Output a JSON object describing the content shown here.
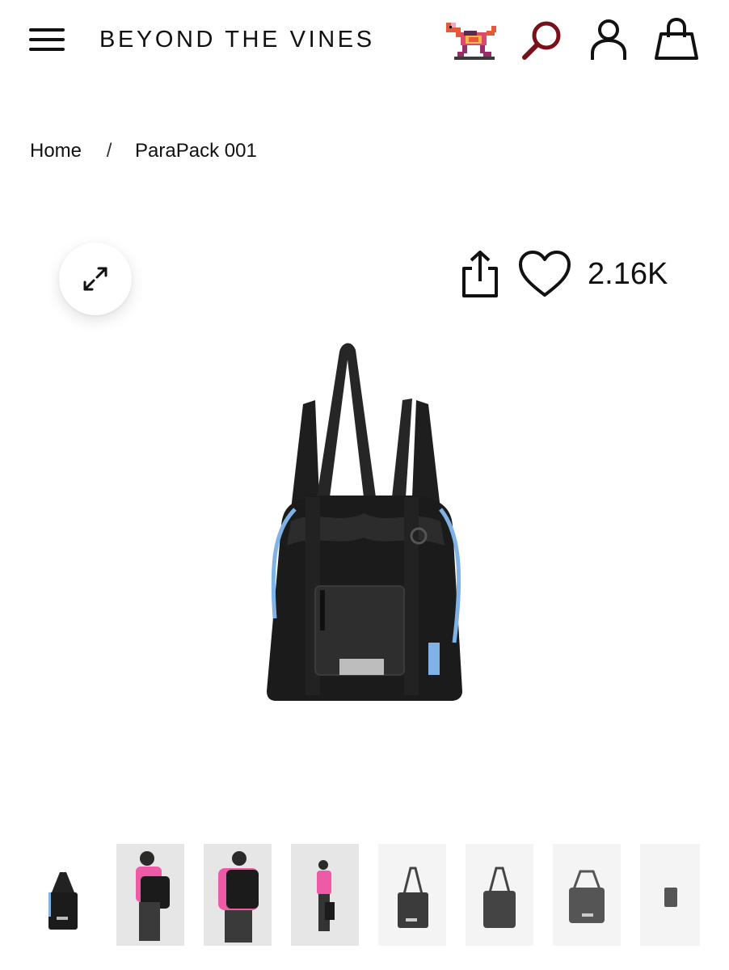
{
  "header": {
    "brand": "BEYOND THE VINES",
    "icons": [
      "menu-icon",
      "horse-logo",
      "search-icon",
      "account-icon",
      "shopping-bag-icon"
    ]
  },
  "breadcrumb": {
    "home": "Home",
    "separator": "/",
    "current": "ParaPack 001"
  },
  "product": {
    "likes": "2.16K",
    "icons": [
      "expand-icon",
      "share-icon",
      "heart-icon"
    ]
  },
  "thumbnails": {
    "count": 8,
    "selected": 1
  },
  "colors": {
    "search_accent": "#7a0f1a",
    "text": "#111111",
    "bag_blue_drawcord": "#7fb3e8"
  }
}
